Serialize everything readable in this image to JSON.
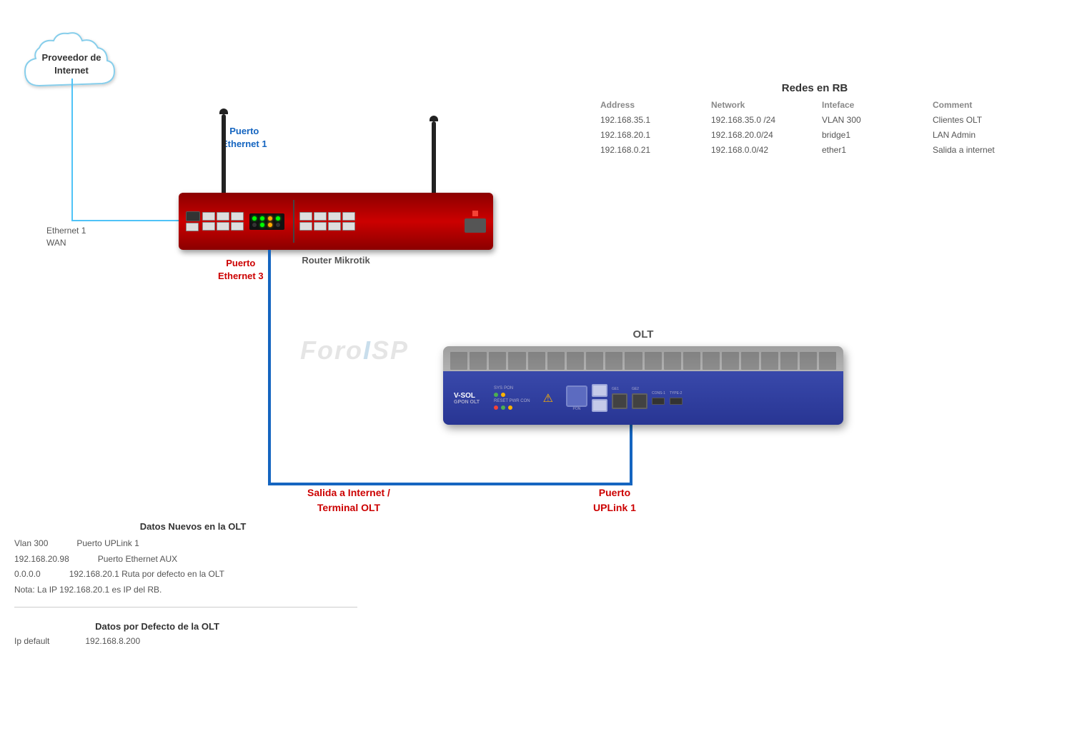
{
  "cloud": {
    "label_line1": "Proveedor de",
    "label_line2": "Internet"
  },
  "connections": {
    "eth1_label_line1": "Ethernet 1",
    "eth1_label_line2": "WAN"
  },
  "router": {
    "puerto_eth1_line1": "Puerto",
    "puerto_eth1_line2": "Ethernet 1",
    "puerto_eth3_line1": "Puerto",
    "puerto_eth3_line2": "Ethernet 3",
    "label": "Router Mikrotik"
  },
  "cable": {
    "salida_line1": "Salida a Internet /",
    "salida_line2": "Terminal  OLT",
    "uplink_line1": "Puerto",
    "uplink_line2": "UPLink 1"
  },
  "olt": {
    "label": "OLT",
    "brand": "V-SOL",
    "model": "GPON OLT"
  },
  "redes_table": {
    "title": "Redes en RB",
    "headers": [
      "Address",
      "Network",
      "Inteface",
      "Comment"
    ],
    "rows": [
      [
        "192.168.35.1",
        "192.168.35.0 /24",
        "VLAN 300",
        "Clientes OLT"
      ],
      [
        "192.168.20.1",
        "192.168.20.0/24",
        "bridge1",
        "LAN Admin"
      ],
      [
        "192.168.0.21",
        "192.168.0.0/42",
        "ether1",
        "Salida a internet"
      ]
    ]
  },
  "datos_nuevos": {
    "title": "Datos Nuevos en  la OLT",
    "rows": [
      {
        "col1": "Vlan 300",
        "col2": "Puerto UPLink 1"
      },
      {
        "col1": "192.168.20.98",
        "col2": "Puerto Ethernet AUX"
      },
      {
        "col1": "0.0.0.0",
        "col2": "192.168.20.1    Ruta  por defecto en la OLT"
      },
      {
        "col1": "Nota: La IP 192.168.20.1 es IP del RB.",
        "col2": ""
      }
    ]
  },
  "datos_defecto": {
    "title": "Datos por Defecto de la OLT",
    "row": {
      "col1": "Ip default",
      "col2": "192.168.8.200"
    }
  },
  "watermark": {
    "text_pre": "Foro",
    "text_dot": "I",
    "text_post": "SP"
  }
}
